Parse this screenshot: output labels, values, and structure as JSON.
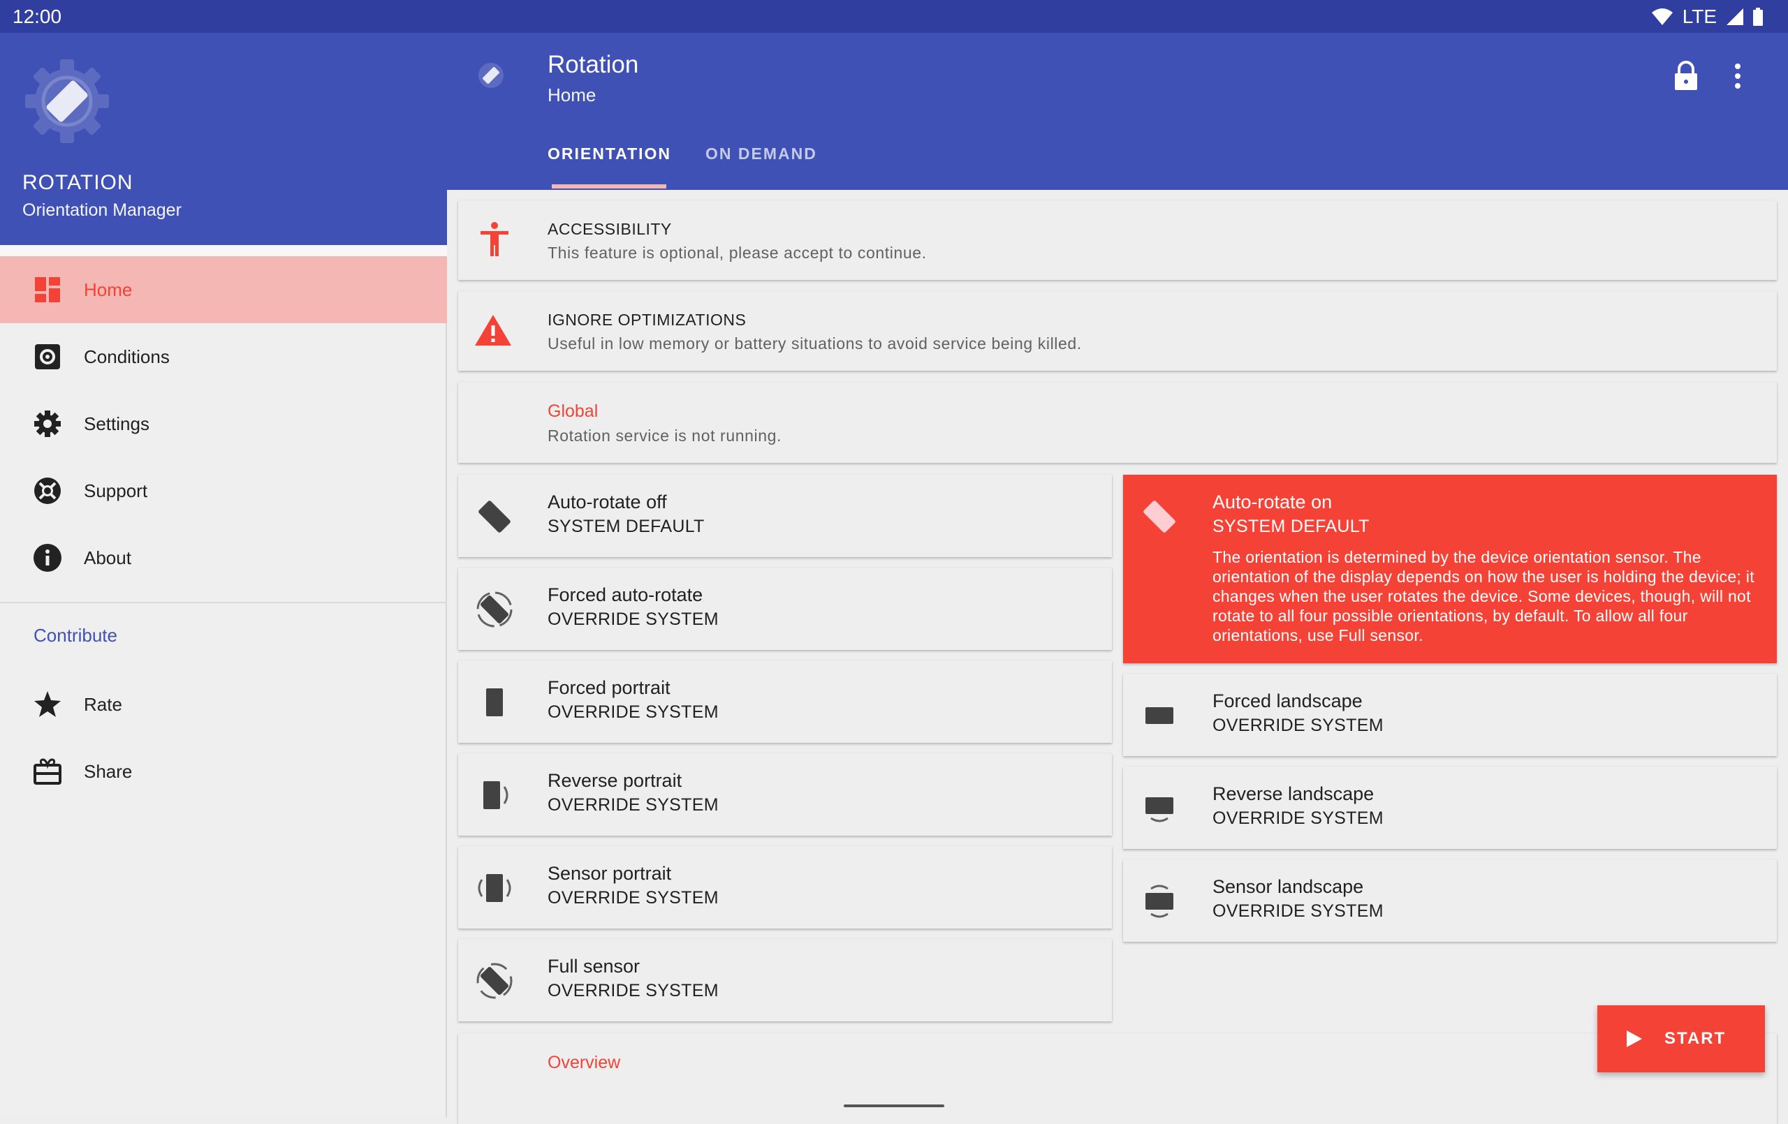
{
  "status_bar": {
    "time": "12:00",
    "network": "LTE"
  },
  "drawer": {
    "app_name": "ROTATION",
    "app_subtitle": "Orientation Manager",
    "items": [
      {
        "label": "Home",
        "icon": "dashboard-icon",
        "active": true
      },
      {
        "label": "Conditions",
        "icon": "conditions-icon"
      },
      {
        "label": "Settings",
        "icon": "gear-icon"
      },
      {
        "label": "Support",
        "icon": "support-icon"
      },
      {
        "label": "About",
        "icon": "info-icon"
      }
    ],
    "section_title": "Contribute",
    "section_items": [
      {
        "label": "Rate",
        "icon": "star-icon"
      },
      {
        "label": "Share",
        "icon": "share-icon"
      }
    ]
  },
  "appbar": {
    "title": "Rotation",
    "subtitle": "Home",
    "tabs": [
      {
        "label": "ORIENTATION",
        "selected": true
      },
      {
        "label": "ON DEMAND",
        "selected": false
      }
    ]
  },
  "cards": {
    "accessibility": {
      "title": "ACCESSIBILITY",
      "subtitle": "This feature is optional, please accept to continue."
    },
    "optimizations": {
      "title": "IGNORE OPTIMIZATIONS",
      "subtitle": "Useful in low memory or battery situations to avoid service being killed."
    },
    "global": {
      "title": "Global",
      "subtitle": "Rotation service is not running."
    }
  },
  "left_items": [
    {
      "title": "Auto-rotate off",
      "subtitle": "SYSTEM DEFAULT",
      "icon": "auto-rotate-off-icon"
    },
    {
      "title": "Forced auto-rotate",
      "subtitle": "OVERRIDE SYSTEM",
      "icon": "forced-auto-rotate-icon"
    },
    {
      "title": "Forced portrait",
      "subtitle": "OVERRIDE SYSTEM",
      "icon": "portrait-icon"
    },
    {
      "title": "Reverse portrait",
      "subtitle": "OVERRIDE SYSTEM",
      "icon": "reverse-portrait-icon"
    },
    {
      "title": "Sensor portrait",
      "subtitle": "OVERRIDE SYSTEM",
      "icon": "sensor-portrait-icon"
    },
    {
      "title": "Full sensor",
      "subtitle": "OVERRIDE SYSTEM",
      "icon": "full-sensor-icon"
    }
  ],
  "selected_item": {
    "title": "Auto-rotate on",
    "subtitle": "SYSTEM DEFAULT",
    "description": "The orientation is determined by the device orientation sensor. The orientation of the display depends on how the user is holding the device; it changes when the user rotates the device. Some devices, though, will not rotate to all four possible orientations, by default. To allow all four orientations, use Full sensor."
  },
  "right_items": [
    {
      "title": "Forced landscape",
      "subtitle": "OVERRIDE SYSTEM",
      "icon": "landscape-icon"
    },
    {
      "title": "Reverse landscape",
      "subtitle": "OVERRIDE SYSTEM",
      "icon": "reverse-landscape-icon"
    },
    {
      "title": "Sensor landscape",
      "subtitle": "OVERRIDE SYSTEM",
      "icon": "sensor-landscape-icon"
    }
  ],
  "overview": {
    "title": "Overview"
  },
  "fab": {
    "label": "START"
  },
  "colors": {
    "primary": "#3f51b5",
    "primary_dark": "#303f9f",
    "accent": "#f44336",
    "active_bg": "#f4b7b3"
  }
}
